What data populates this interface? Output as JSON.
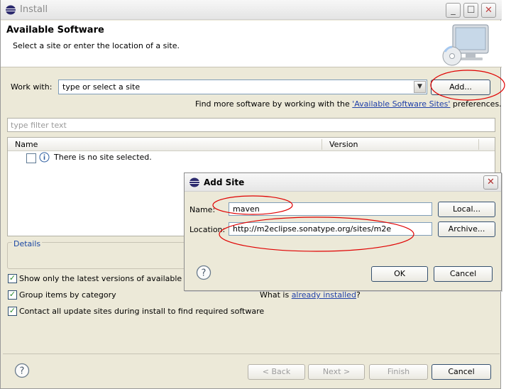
{
  "window": {
    "title": "Install"
  },
  "header": {
    "title": "Available Software",
    "description": "Select a site or enter the location of a site."
  },
  "work_with": {
    "label": "Work with:",
    "value": "type or select a site",
    "add_label": "Add..."
  },
  "find_more": {
    "prefix": "Find more software by working with the ",
    "link": "'Available Software Sites'",
    "suffix": " preferences."
  },
  "filter": {
    "placeholder": "type filter text"
  },
  "table": {
    "columns": [
      "Name",
      "Version"
    ],
    "empty_row": "There is no site selected."
  },
  "details": {
    "label": "Details"
  },
  "options": {
    "show_latest": "Show only the latest versions of available sc",
    "group_items": "Group items by category",
    "contact_sites": "Contact all update sites during install to find required software",
    "what_is": "What is ",
    "already_installed": "already installed",
    "qmark": "?"
  },
  "footer": {
    "back": "< Back",
    "next": "Next >",
    "finish": "Finish",
    "cancel": "Cancel"
  },
  "dialog": {
    "title": "Add Site",
    "name_label": "Name:",
    "name_value": "maven",
    "location_label": "Location:",
    "location_value": "http://m2eclipse.sonatype.org/sites/m2e",
    "local_label": "Local...",
    "archive_label": "Archive...",
    "ok_label": "OK",
    "cancel_label": "Cancel"
  },
  "colors": {
    "annotation": "#e00000",
    "link": "#1f3fa8",
    "window_bg": "#ece9d8"
  }
}
